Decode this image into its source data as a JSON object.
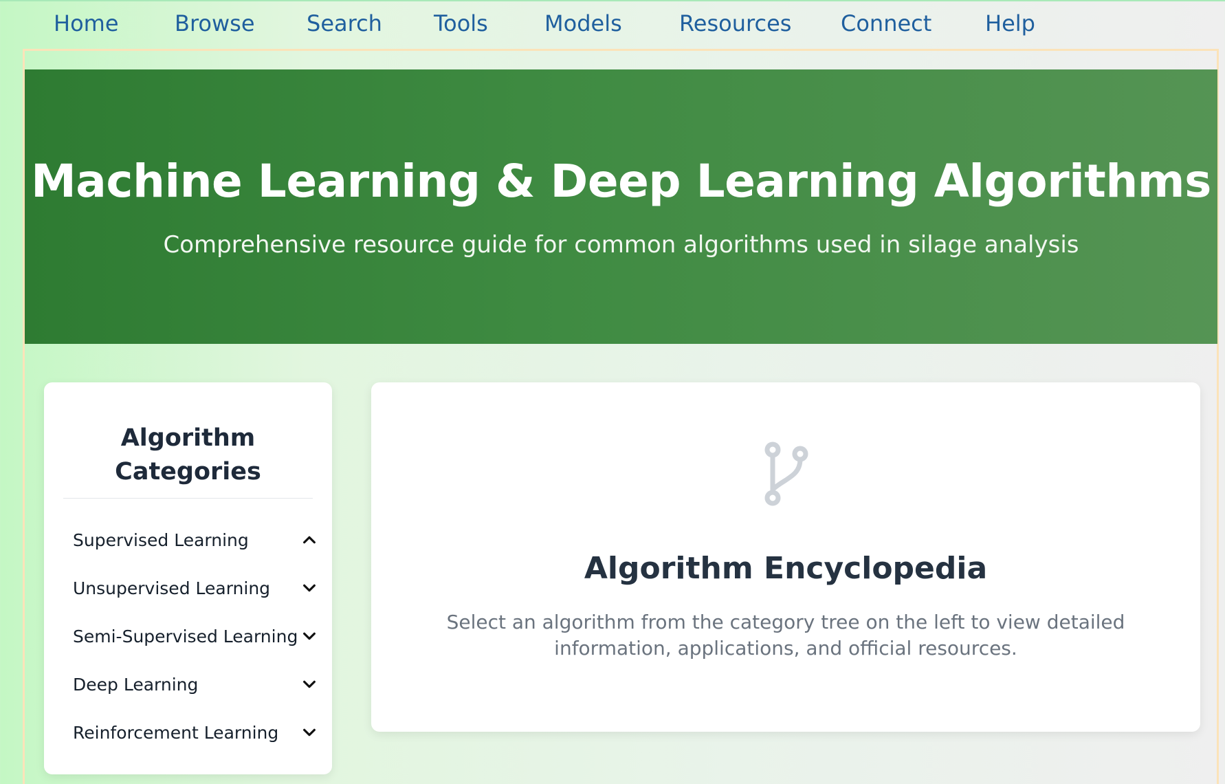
{
  "nav": {
    "items": [
      {
        "label": "Home"
      },
      {
        "label": "Browse"
      },
      {
        "label": "Search"
      },
      {
        "label": "Tools"
      },
      {
        "label": "Models"
      },
      {
        "label": "Resources"
      },
      {
        "label": "Connect"
      },
      {
        "label": "Help"
      }
    ],
    "link_color": "#1f5f9e"
  },
  "hero": {
    "title": "Machine Learning & Deep Learning Algorithms",
    "subtitle": "Comprehensive resource guide for common algorithms used in silage analysis",
    "background_color": "#3b863e"
  },
  "sidebar": {
    "title": "Algorithm Categories",
    "categories": [
      {
        "label": "Supervised Learning",
        "icon": "chevron-up-icon",
        "expanded": true
      },
      {
        "label": "Unsupervised Learning",
        "icon": "chevron-down-icon",
        "expanded": false
      },
      {
        "label": "Semi-Supervised Learning",
        "icon": "chevron-down-icon",
        "expanded": false
      },
      {
        "label": "Deep Learning",
        "icon": "chevron-down-icon",
        "expanded": false
      },
      {
        "label": "Reinforcement Learning",
        "icon": "chevron-down-icon",
        "expanded": false
      }
    ]
  },
  "content": {
    "icon": "code-branch-icon",
    "title": "Algorithm Encyclopedia",
    "description": "Select an algorithm from the category tree on the left to view detailed information, applications, and official resources."
  }
}
